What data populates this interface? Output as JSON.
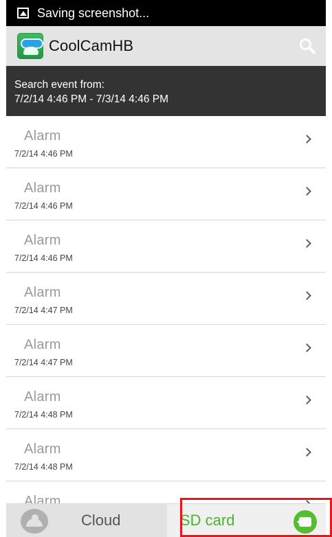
{
  "status_bar": {
    "text": "Saving screenshot..."
  },
  "app_bar": {
    "title": "CoolCamHB",
    "logo_icon": "coolcam-logo-icon",
    "search_icon": "search-icon"
  },
  "search_range": {
    "label": "Search event from:",
    "range": "7/2/14 4:46 PM - 7/3/14 4:46 PM"
  },
  "events": [
    {
      "title": "Alarm",
      "time": "7/2/14 4:46 PM"
    },
    {
      "title": "Alarm",
      "time": "7/2/14 4:46 PM"
    },
    {
      "title": "Alarm",
      "time": "7/2/14 4:46 PM"
    },
    {
      "title": "Alarm",
      "time": "7/2/14 4:47 PM"
    },
    {
      "title": "Alarm",
      "time": "7/2/14 4:47 PM"
    },
    {
      "title": "Alarm",
      "time": "7/2/14 4:48 PM"
    },
    {
      "title": "Alarm",
      "time": "7/2/14 4:48 PM"
    },
    {
      "title": "Alarm",
      "time": ""
    }
  ],
  "bottom_tabs": [
    {
      "label": "Cloud",
      "icon": "cloud-icon",
      "selected": false
    },
    {
      "label": "SD card",
      "icon": "video-camera-icon",
      "selected": true
    }
  ],
  "colors": {
    "status_bar": "#000000",
    "app_bar": "#e4e4e4",
    "range_bar": "#333333",
    "selected_tab": "#47b42f",
    "highlight": "#e71717"
  }
}
